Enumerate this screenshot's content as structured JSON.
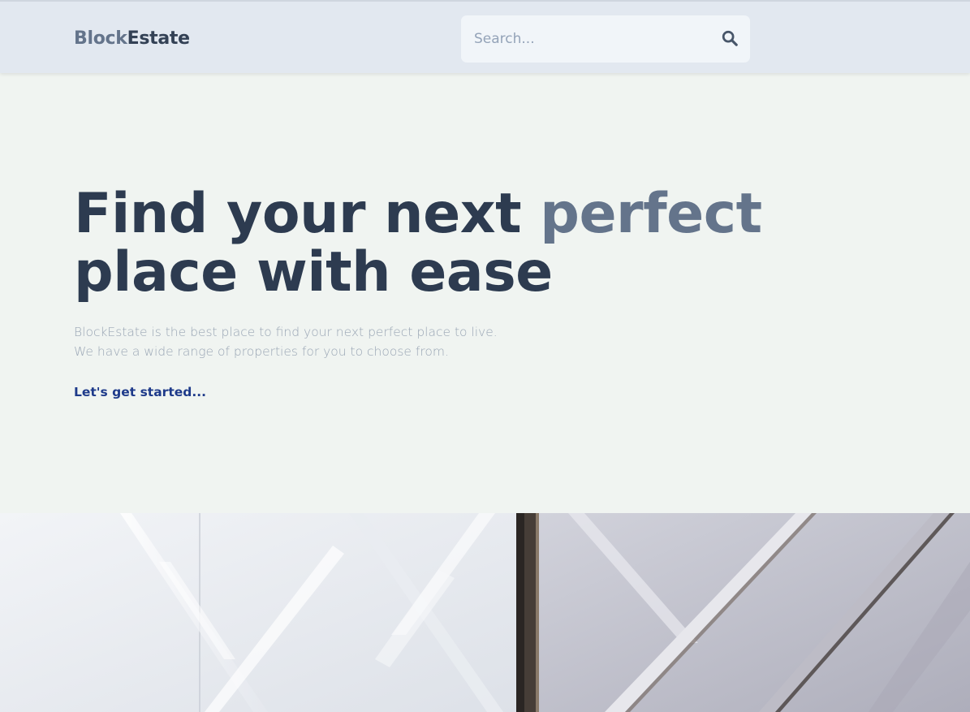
{
  "header": {
    "logo_part1": "Block",
    "logo_part2": "Estate",
    "search": {
      "placeholder": "Search...",
      "value": ""
    }
  },
  "hero": {
    "headline_part1": "Find your next ",
    "headline_accent": "perfect",
    "headline_line2": "place with ease",
    "description_line1": "BlockEstate is the best place to find your next perfect place to live.",
    "description_line2": "We have a wide range of properties for you to choose from.",
    "cta_label": "Let's get started..."
  },
  "icons": {
    "search": "search-icon"
  },
  "colors": {
    "header_bg": "#e2e8f0",
    "hero_bg": "#f0f4f1",
    "headline": "#2d3b50",
    "accent": "#64748b",
    "cta": "#1e3a8a",
    "description": "#9aa6b5"
  }
}
